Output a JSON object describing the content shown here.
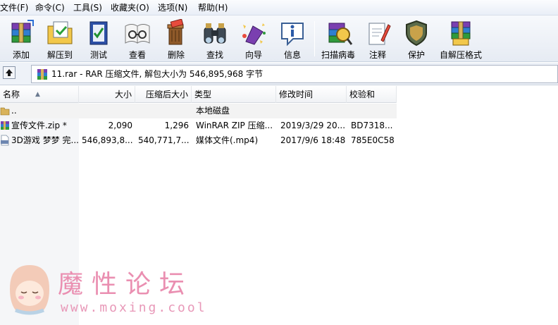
{
  "menu": [
    "文件(F)",
    "命令(C)",
    "工具(S)",
    "收藏夹(O)",
    "选项(N)",
    "帮助(H)"
  ],
  "toolbar": [
    {
      "label": "添加",
      "icon": "add-archive-icon"
    },
    {
      "label": "解压到",
      "icon": "extract-to-icon"
    },
    {
      "label": "测试",
      "icon": "test-icon"
    },
    {
      "label": "查看",
      "icon": "view-icon"
    },
    {
      "label": "删除",
      "icon": "delete-icon"
    },
    {
      "label": "查找",
      "icon": "find-icon"
    },
    {
      "label": "向导",
      "icon": "wizard-icon"
    },
    {
      "label": "信息",
      "icon": "info-icon"
    },
    {
      "label": "扫描病毒",
      "icon": "virus-scan-icon"
    },
    {
      "label": "注释",
      "icon": "comment-icon"
    },
    {
      "label": "保护",
      "icon": "protect-icon"
    },
    {
      "label": "自解压格式",
      "icon": "sfx-icon"
    }
  ],
  "address": {
    "text": "11.rar - RAR 压缩文件, 解包大小为 546,895,968 字节"
  },
  "columns": [
    "名称",
    "大小",
    "压缩后大小",
    "类型",
    "修改时间",
    "校验和"
  ],
  "rows": [
    {
      "name": "..",
      "size": "",
      "packed": "",
      "type": "本地磁盘",
      "modified": "",
      "crc": "",
      "icon": "folder-up-icon"
    },
    {
      "name": "宣传文件.zip *",
      "size": "2,090",
      "packed": "1,296",
      "type": "WinRAR ZIP 压缩...",
      "modified": "2019/3/29 20...",
      "crc": "BD7318...",
      "icon": "zip-archive-icon"
    },
    {
      "name": "3D游戏 梦梦 完...",
      "size": "546,893,8...",
      "packed": "540,771,7...",
      "type": "媒体文件(.mp4)",
      "modified": "2017/9/6 18:48",
      "crc": "785E0C58",
      "icon": "mp4-file-icon"
    }
  ],
  "watermark": {
    "title": "魔性论坛",
    "url": "www.moxing.cool"
  }
}
